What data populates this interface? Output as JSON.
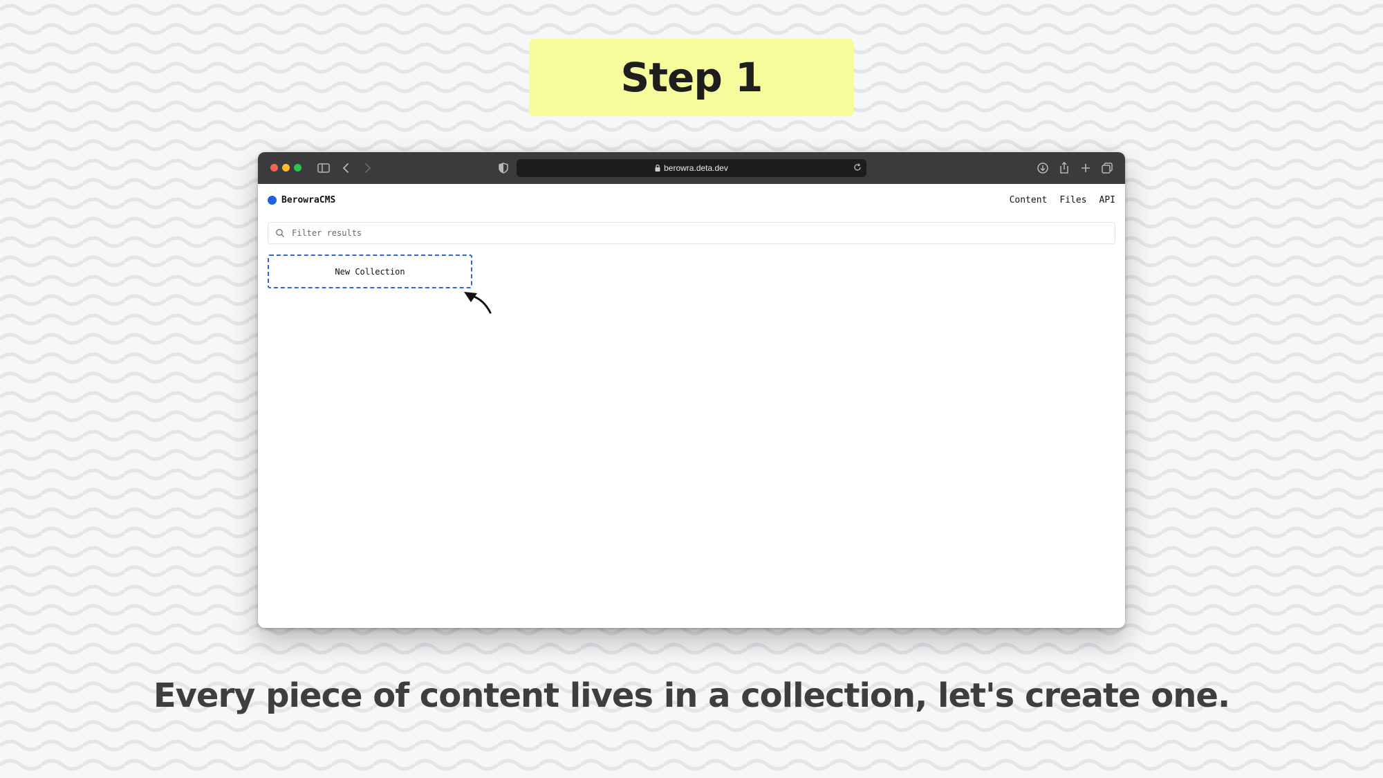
{
  "step_label": "Step 1",
  "browser": {
    "url": "berowra.deta.dev",
    "icons": [
      "sidebar-icon",
      "back-icon",
      "forward-icon",
      "shield-icon",
      "lock-icon",
      "reload-icon",
      "download-icon",
      "share-icon",
      "new-tab-icon",
      "tabs-overview-icon"
    ]
  },
  "app": {
    "brand": "BerowraCMS",
    "nav": [
      "Content",
      "Files",
      "API"
    ],
    "filter_placeholder": "Filter results",
    "new_collection_label": "New Collection"
  },
  "caption": "Every piece of content lives in a collection, let's create one.",
  "colors": {
    "badge": "#f6fb9c",
    "accent_blue": "#2e62de",
    "titlebar": "#3b3b3d"
  }
}
